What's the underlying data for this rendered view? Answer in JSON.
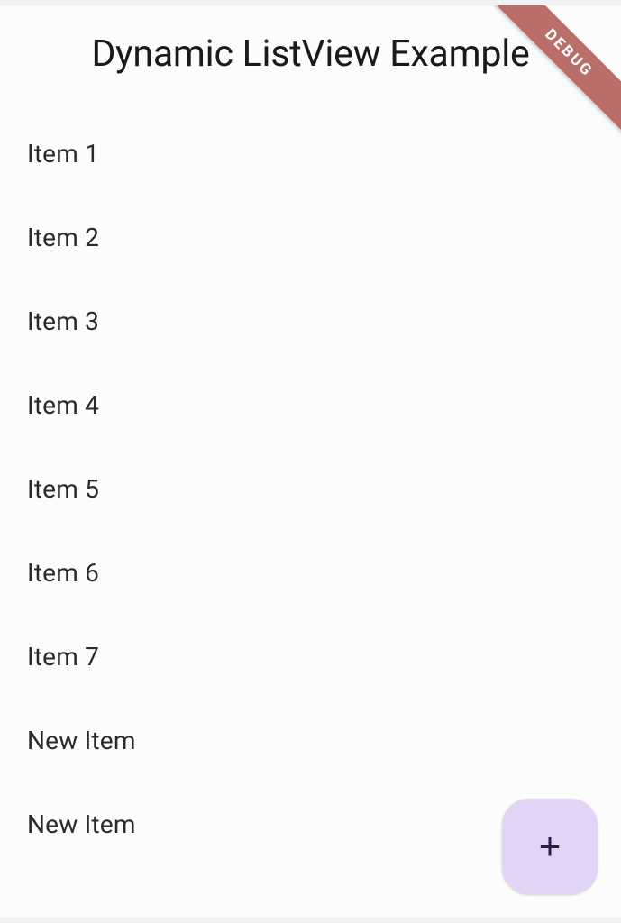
{
  "appBar": {
    "title": "Dynamic ListView Example"
  },
  "list": {
    "items": [
      {
        "label": "Item 1"
      },
      {
        "label": "Item 2"
      },
      {
        "label": "Item 3"
      },
      {
        "label": "Item 4"
      },
      {
        "label": "Item 5"
      },
      {
        "label": "Item 6"
      },
      {
        "label": "Item 7"
      },
      {
        "label": "New Item"
      },
      {
        "label": "New Item"
      }
    ]
  },
  "fab": {
    "iconName": "plus-icon",
    "iconGlyph": "+"
  },
  "debugBanner": {
    "label": "DEBUG"
  }
}
